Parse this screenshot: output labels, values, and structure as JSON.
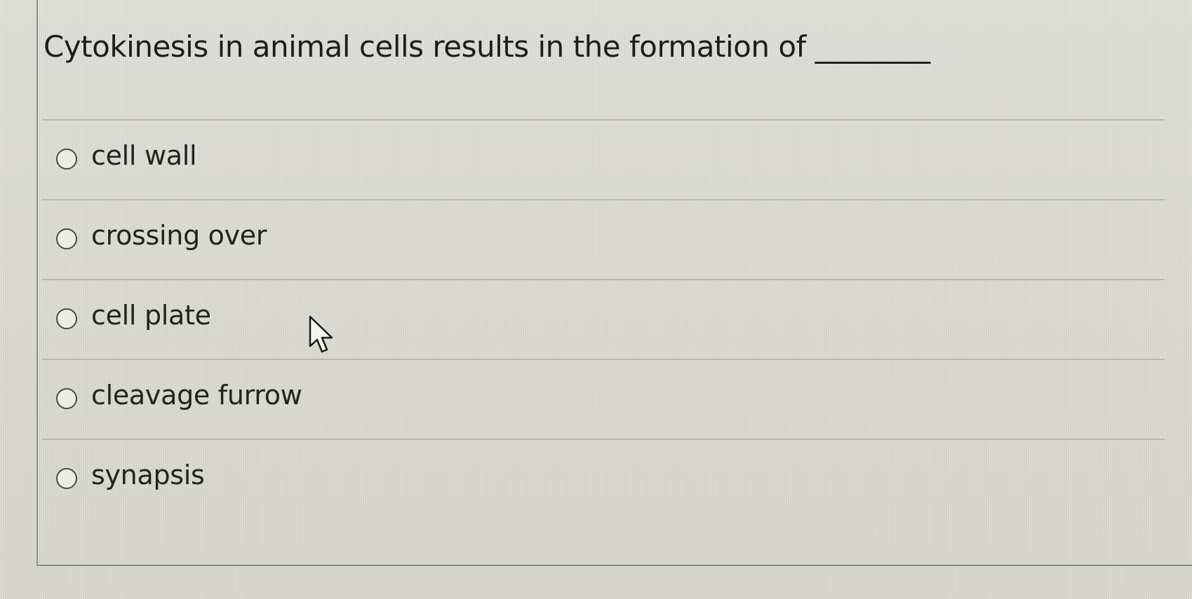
{
  "question": {
    "text": "Cytokinesis in animal cells results in the formation of ________"
  },
  "options": [
    {
      "label": "cell wall",
      "selected": false
    },
    {
      "label": "crossing over",
      "selected": false
    },
    {
      "label": "cell plate",
      "selected": false
    },
    {
      "label": "cleavage furrow",
      "selected": false
    },
    {
      "label": "synapsis",
      "selected": false
    }
  ],
  "icons": {
    "cursor": "mouse-pointer-icon",
    "radio": "radio-button-icon"
  },
  "colors": {
    "background": "#ddddd6",
    "text": "#1e1e1e",
    "divider": "#b9b9b1",
    "panel_border": "#8e8e88"
  }
}
